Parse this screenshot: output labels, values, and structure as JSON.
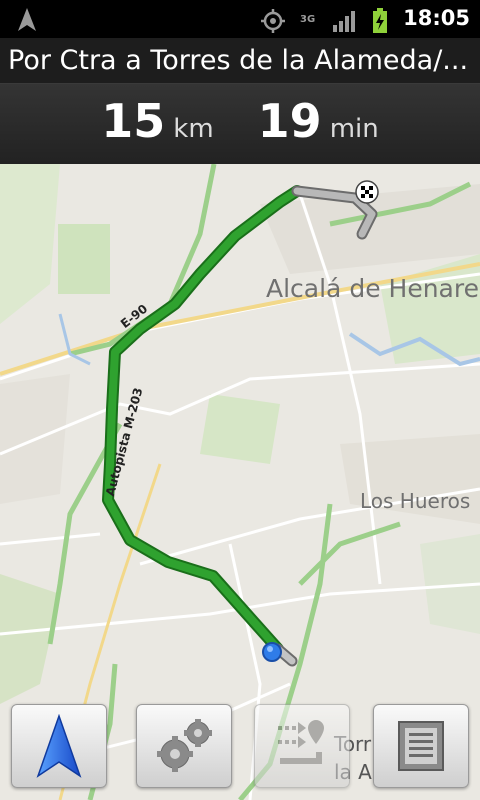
{
  "status_bar": {
    "time": "18:05",
    "network": "3G",
    "icons": [
      "navigation-arrow-icon",
      "gps-icon",
      "3g-data-icon",
      "signal-icon",
      "battery-charging-icon"
    ]
  },
  "route": {
    "title": "Por Ctra a Torres de la Alameda/...",
    "distance_value": "15",
    "distance_unit": "km",
    "time_value": "19",
    "time_unit": "min"
  },
  "map": {
    "places": {
      "alcala": "Alcalá de Henares",
      "hueros": "Los Hueros",
      "torres_line1": "Torr",
      "torres_line2": "la Al"
    },
    "roads": {
      "e90": "E-90",
      "m203": "Autopista M-203"
    },
    "colors": {
      "route": "#2fa22f",
      "route_dark": "#1a6f1a",
      "highway": "#9ccf8a",
      "water": "#a8c6e6"
    }
  },
  "buttons": {
    "navigate": "navigate-icon",
    "settings": "settings-icon",
    "route_steps": "route-steps-icon",
    "directions_list": "directions-list-icon"
  }
}
